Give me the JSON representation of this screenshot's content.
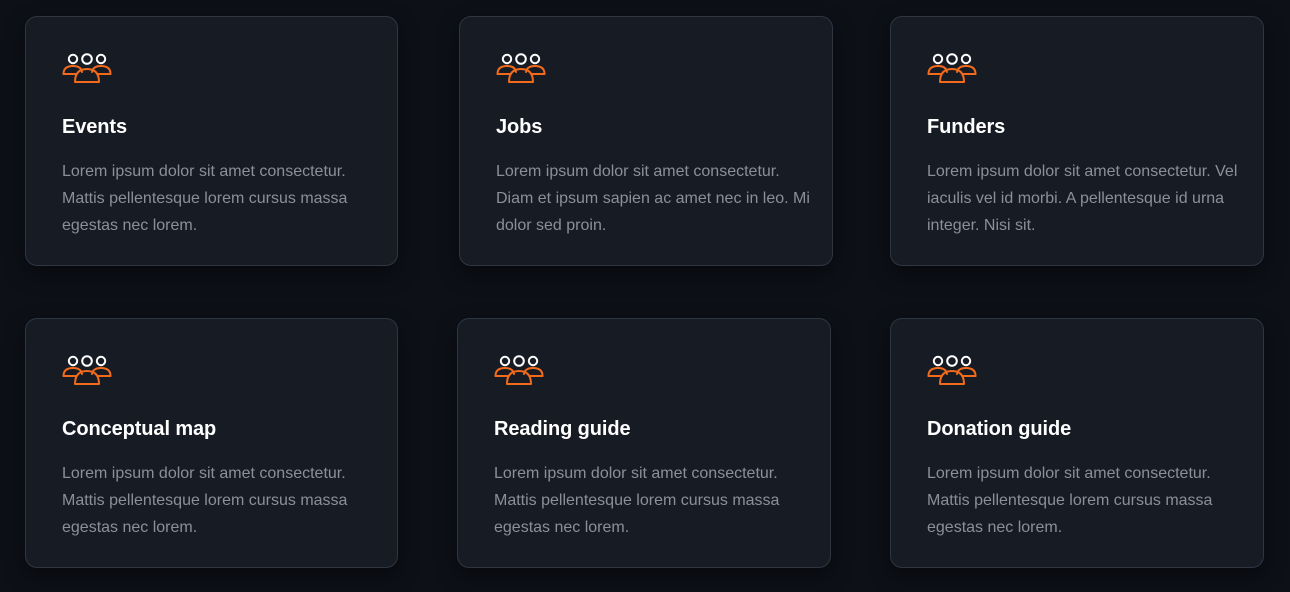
{
  "colors": {
    "background": "#0d1017",
    "card": "#171c24",
    "card_border": "#2f3642",
    "accent": "#f26a1b",
    "title": "#ffffff",
    "text": "#8a9099"
  },
  "icon_name": "users-group-icon",
  "cards": [
    {
      "title": "Events",
      "description": "Lorem ipsum dolor sit amet consectetur. Mattis pellentesque lorem cursus massa egestas nec lorem."
    },
    {
      "title": "Jobs",
      "description": "Lorem ipsum dolor sit amet consectetur. Diam et ipsum sapien ac amet nec in leo. Mi dolor sed proin."
    },
    {
      "title": "Funders",
      "description": "Lorem ipsum dolor sit amet consectetur. Vel iaculis vel id morbi. A pellentesque id urna integer. Nisi sit."
    },
    {
      "title": "Conceptual map",
      "description": "Lorem ipsum dolor sit amet consectetur. Mattis pellentesque lorem cursus massa egestas nec lorem."
    },
    {
      "title": "Reading guide",
      "description": "Lorem ipsum dolor sit amet consectetur. Mattis pellentesque lorem cursus massa egestas nec lorem."
    },
    {
      "title": "Donation guide",
      "description": "Lorem ipsum dolor sit amet consectetur. Mattis pellentesque lorem cursus massa egestas nec lorem."
    }
  ]
}
